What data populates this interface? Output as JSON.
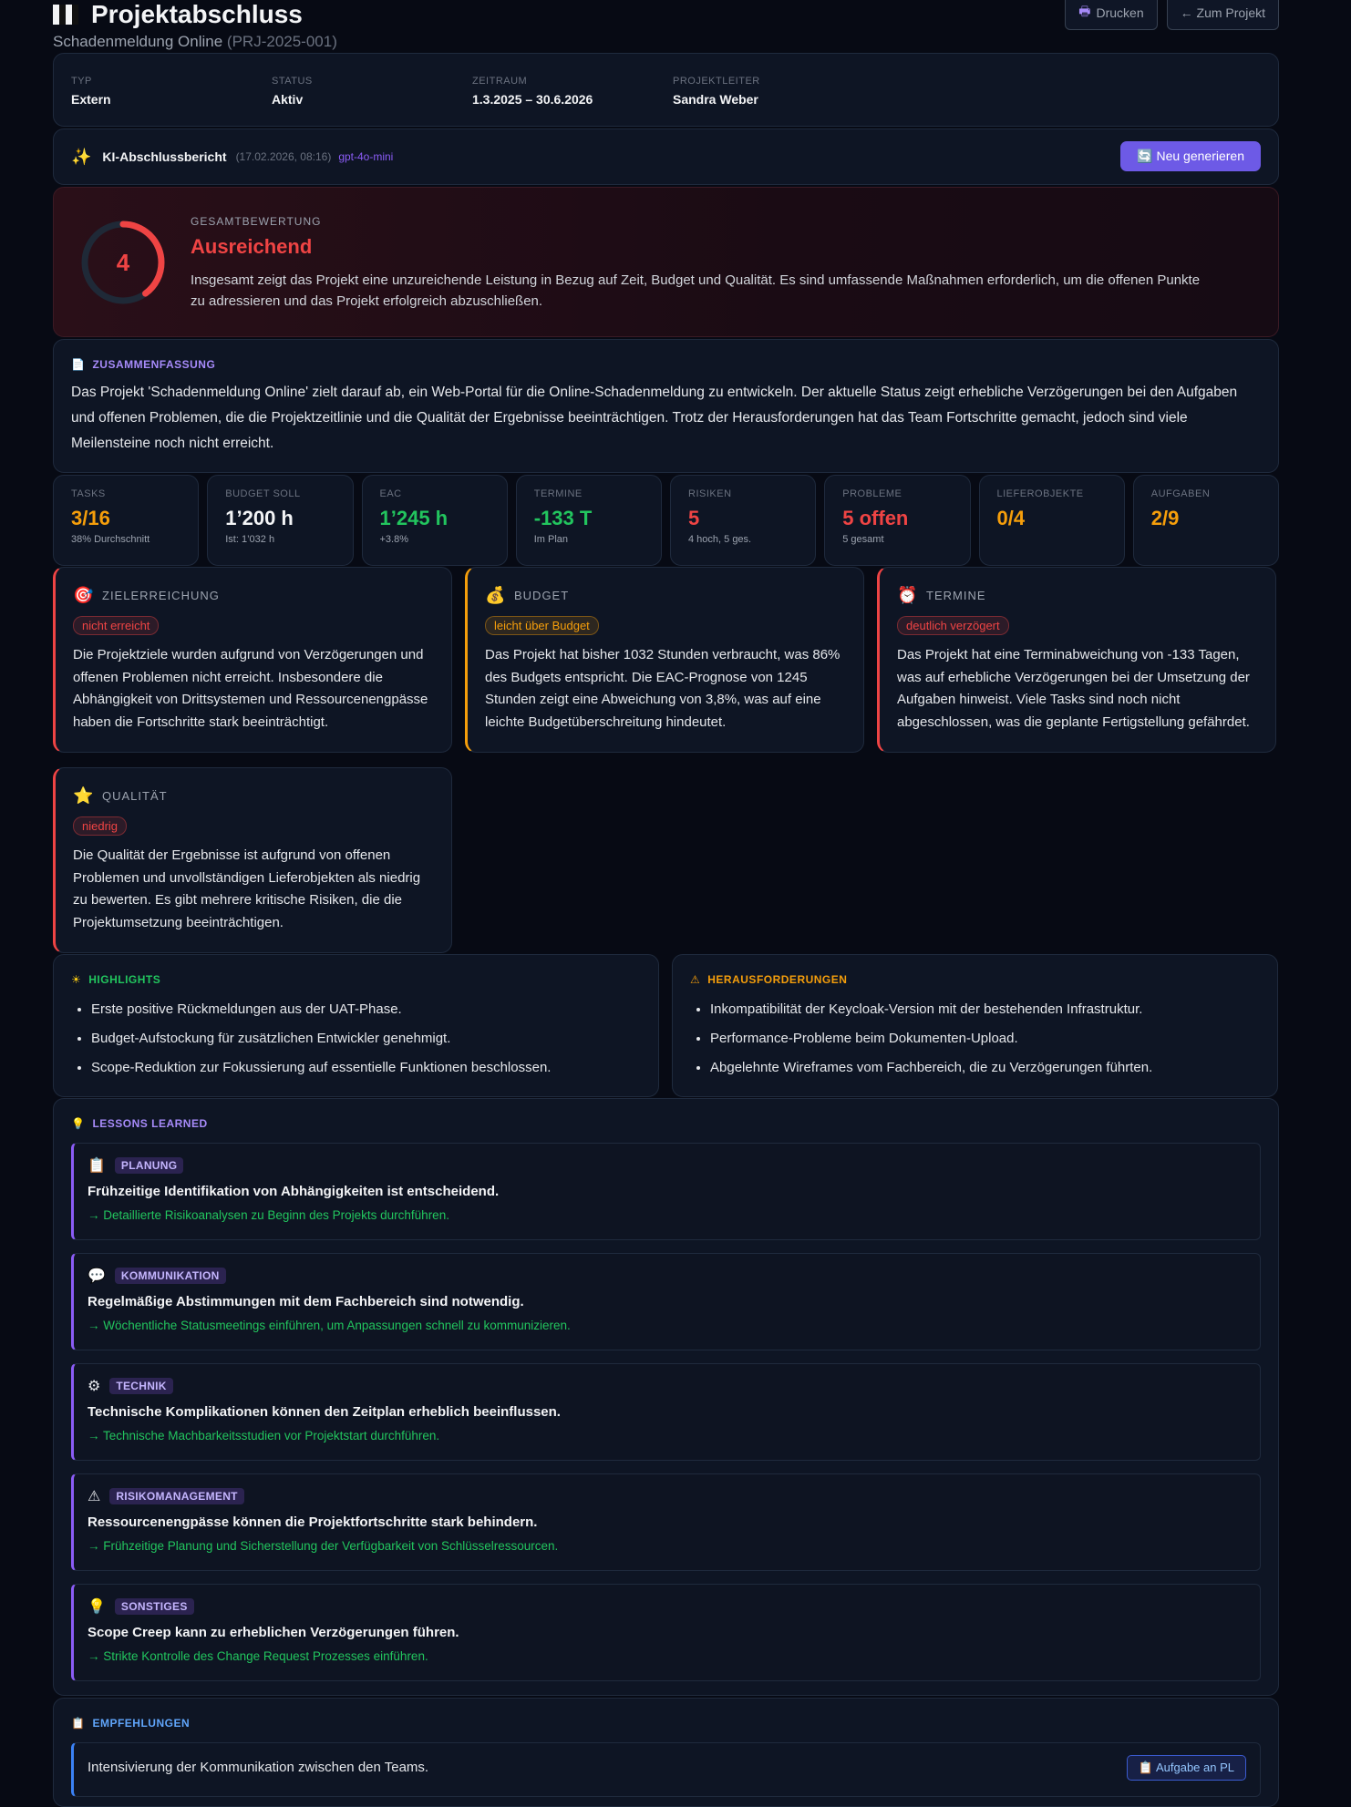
{
  "header": {
    "title": "Projektabschluss",
    "project_name": "Schadenmeldung Online",
    "project_code": "(PRJ-2025-001)",
    "print_label": "Drucken",
    "back_label": "← Zum Projekt"
  },
  "info": [
    {
      "label": "TYP",
      "value": "Extern"
    },
    {
      "label": "STATUS",
      "value": "Aktiv"
    },
    {
      "label": "ZEITRAUM",
      "value": "1.3.2025 – 30.6.2026"
    },
    {
      "label": "PROJEKTLEITER",
      "value": "Sandra Weber"
    }
  ],
  "ki": {
    "title": "KI-Abschlussbericht",
    "date": "(17.02.2026, 08:16)",
    "model": "gpt-4o-mini",
    "regenerate_label": "Neu generieren"
  },
  "grade": {
    "score": "4",
    "score_fraction": 0.4,
    "label": "GESAMTBEWERTUNG",
    "title": "Ausreichend",
    "text": "Insgesamt zeigt das Projekt eine unzureichende Leistung in Bezug auf Zeit, Budget und Qualität. Es sind umfassende Maßnahmen erforderlich, um die offenen Punkte zu adressieren und das Projekt erfolgreich abzuschließen.",
    "color": "#ef4444"
  },
  "summary": {
    "heading": "ZUSAMMENFASSUNG",
    "text": "Das Projekt 'Schadenmeldung Online' zielt darauf ab, ein Web-Portal für die Online-Schadenmeldung zu entwickeln. Der aktuelle Status zeigt erhebliche Verzögerungen bei den Aufgaben und offenen Problemen, die die Projektzeitlinie und die Qualität der Ergebnisse beeinträchtigen. Trotz der Herausforderungen hat das Team Fortschritte gemacht, jedoch sind viele Meilensteine noch nicht erreicht."
  },
  "kpis": [
    {
      "label": "TASKS",
      "value": "3/16",
      "sub": "38% Durchschnitt",
      "color": "#f59e0b"
    },
    {
      "label": "BUDGET SOLL",
      "value": "1’200 h",
      "sub": "Ist: 1’032 h",
      "color": "#f3f4f6"
    },
    {
      "label": "EAC",
      "value": "1’245 h",
      "sub": "+3.8%",
      "color": "#22c55e"
    },
    {
      "label": "TERMINE",
      "value": "-133 T",
      "sub": "Im Plan",
      "color": "#22c55e"
    },
    {
      "label": "RISIKEN",
      "value": "5",
      "sub": "4 hoch, 5 ges.",
      "color": "#ef4444"
    },
    {
      "label": "PROBLEME",
      "value": "5 offen",
      "sub": "5 gesamt",
      "color": "#ef4444"
    },
    {
      "label": "LIEFEROBJEKTE",
      "value": "0/4",
      "sub": "",
      "color": "#f59e0b"
    },
    {
      "label": "AUFGABEN",
      "value": "2/9",
      "sub": "",
      "color": "#f59e0b"
    }
  ],
  "evaluations": [
    {
      "title": "ZIELERREICHUNG",
      "icon": "target-icon",
      "glyph": "🎯",
      "badge": "nicht erreicht",
      "color": "#ef4444",
      "text": "Die Projektziele wurden aufgrund von Verzögerungen und offenen Problemen nicht erreicht. Insbesondere die Abhängigkeit von Drittsystemen und Ressourcenengpässe haben die Fortschritte stark beeinträchtigt."
    },
    {
      "title": "BUDGET",
      "icon": "money-bag-icon",
      "glyph": "💰",
      "badge": "leicht über Budget",
      "color": "#f59e0b",
      "text": "Das Projekt hat bisher 1032 Stunden verbraucht, was 86% des Budgets entspricht. Die EAC-Prognose von 1245 Stunden zeigt eine Abweichung von 3,8%, was auf eine leichte Budgetüberschreitung hindeutet."
    },
    {
      "title": "TERMINE",
      "icon": "alarm-clock-icon",
      "glyph": "⏰",
      "badge": "deutlich verzögert",
      "color": "#ef4444",
      "text": "Das Projekt hat eine Terminabweichung von -133 Tagen, was auf erhebliche Verzögerungen bei der Umsetzung der Aufgaben hinweist. Viele Tasks sind noch nicht abgeschlossen, was die geplante Fertigstellung gefährdet."
    },
    {
      "title": "QUALITÄT",
      "icon": "star-icon",
      "glyph": "⭐",
      "badge": "niedrig",
      "color": "#ef4444",
      "text": "Die Qualität der Ergebnisse ist aufgrund von offenen Problemen und unvollständigen Lieferobjekten als niedrig zu bewerten. Es gibt mehrere kritische Risiken, die die Projektumsetzung beeinträchtigen."
    }
  ],
  "highlights": {
    "heading": "HIGHLIGHTS",
    "items": [
      "Erste positive Rückmeldungen aus der UAT-Phase.",
      "Budget-Aufstockung für zusätzlichen Entwickler genehmigt.",
      "Scope-Reduktion zur Fokussierung auf essentielle Funktionen beschlossen."
    ]
  },
  "challenges": {
    "heading": "HERAUSFORDERUNGEN",
    "items": [
      "Inkompatibilität der Keycloak-Version mit der bestehenden Infrastruktur.",
      "Performance-Probleme beim Dokumenten-Upload.",
      "Abgelehnte Wireframes vom Fachbereich, die zu Verzögerungen führten."
    ]
  },
  "lessons": {
    "heading": "LESSONS LEARNED",
    "items": [
      {
        "category": "PLANUNG",
        "icon": "clipboard-icon",
        "glyph": "📋",
        "lesson": "Frühzeitige Identifikation von Abhängigkeiten ist entscheidend.",
        "action": "→ Detaillierte Risikoanalysen zu Beginn des Projekts durchführen."
      },
      {
        "category": "KOMMUNIKATION",
        "icon": "speech-bubble-icon",
        "glyph": "💬",
        "lesson": "Regelmäßige Abstimmungen mit dem Fachbereich sind notwendig.",
        "action": "→ Wöchentliche Statusmeetings einführen, um Anpassungen schnell zu kommunizieren."
      },
      {
        "category": "TECHNIK",
        "icon": "gear-icon",
        "glyph": "⚙",
        "lesson": "Technische Komplikationen können den Zeitplan erheblich beeinflussen.",
        "action": "→ Technische Machbarkeitsstudien vor Projektstart durchführen."
      },
      {
        "category": "RISIKOMANAGEMENT",
        "icon": "warning-icon",
        "glyph": "⚠",
        "lesson": "Ressourcenengpässe können die Projektfortschritte stark behindern.",
        "action": "→ Frühzeitige Planung und Sicherstellung der Verfügbarkeit von Schlüsselressourcen."
      },
      {
        "category": "SONSTIGES",
        "icon": "lightbulb-icon",
        "glyph": "💡",
        "lesson": "Scope Creep kann zu erheblichen Verzögerungen führen.",
        "action": "→ Strikte Kontrolle des Change Request Prozesses einführen."
      }
    ]
  },
  "recommendations": {
    "heading": "EMPFEHLUNGEN",
    "items": [
      {
        "text": "Intensivierung der Kommunikation zwischen den Teams.",
        "button": "Aufgabe an PL"
      }
    ]
  }
}
